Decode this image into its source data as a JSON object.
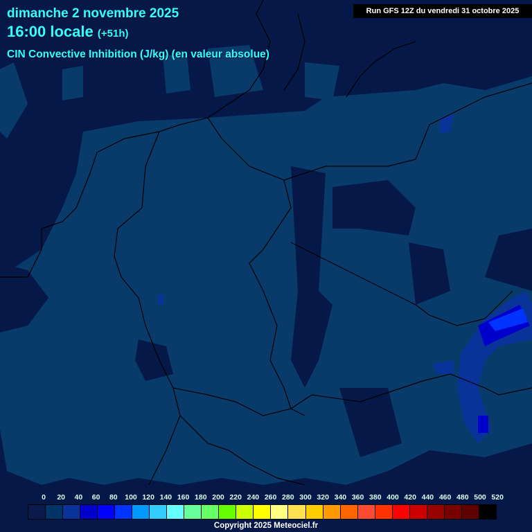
{
  "header": {
    "date": "dimanche 2 novembre 2025",
    "time": "16:00 locale",
    "lead": "(+51h)",
    "parameter": "CIN Convective Inhibition (J/kg) (en valeur absolue)",
    "run": "Run GFS 12Z du vendredi 31 octobre 2025"
  },
  "legend": {
    "labels": [
      "0",
      "20",
      "40",
      "60",
      "80",
      "100",
      "120",
      "140",
      "160",
      "180",
      "200",
      "220",
      "240",
      "260",
      "280",
      "300",
      "320",
      "340",
      "360",
      "380",
      "400",
      "420",
      "440",
      "460",
      "480",
      "500",
      "520"
    ],
    "colors": [
      "#0a1a4a",
      "#003366",
      "#0a3399",
      "#0000cc",
      "#0000ff",
      "#0033ff",
      "#0099ff",
      "#33ccff",
      "#66ffff",
      "#66ff99",
      "#66ff66",
      "#66ff00",
      "#ccff00",
      "#ffff00",
      "#ffff80",
      "#ffe050",
      "#ffcc00",
      "#ff9900",
      "#ff6600",
      "#ff4a33",
      "#ff3300",
      "#ff0000",
      "#cc0000",
      "#990000",
      "#770000",
      "#600000",
      "#000000"
    ]
  },
  "copyright": "Copyright 2025 Meteociel.fr"
}
